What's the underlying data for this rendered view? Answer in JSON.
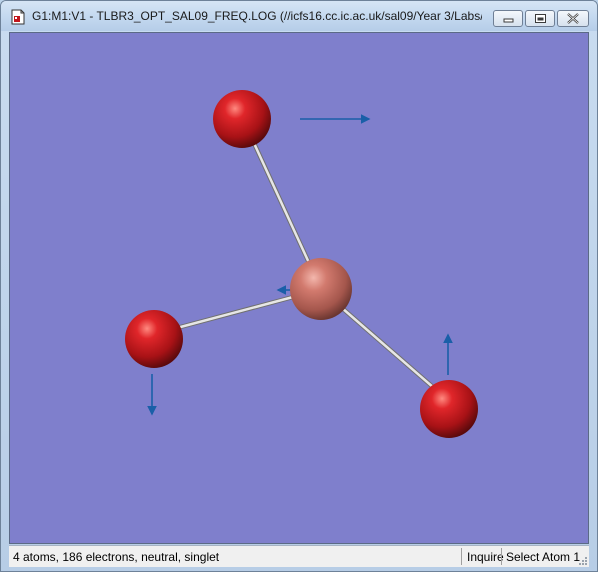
{
  "window": {
    "title": "G1:M1:V1 - TLBR3_OPT_SAL09_FREQ.LOG (//icfs16.cc.ic.ac.uk/sal09/Year 3/Labs/Co...",
    "controls": [
      "minimize-icon",
      "maximize-icon",
      "close-icon"
    ]
  },
  "viewport": {
    "background_color": "#7f7fcc",
    "atom_colors": {
      "Tl": "#c66a5e",
      "Br": "#c2161b"
    },
    "bond_color": "#d4d4d4",
    "vector_color": "#1a5fa8"
  },
  "statusbar": {
    "info": "4 atoms, 186 electrons, neutral, singlet",
    "mode": "Inquire",
    "selection": "Select Atom 1"
  }
}
